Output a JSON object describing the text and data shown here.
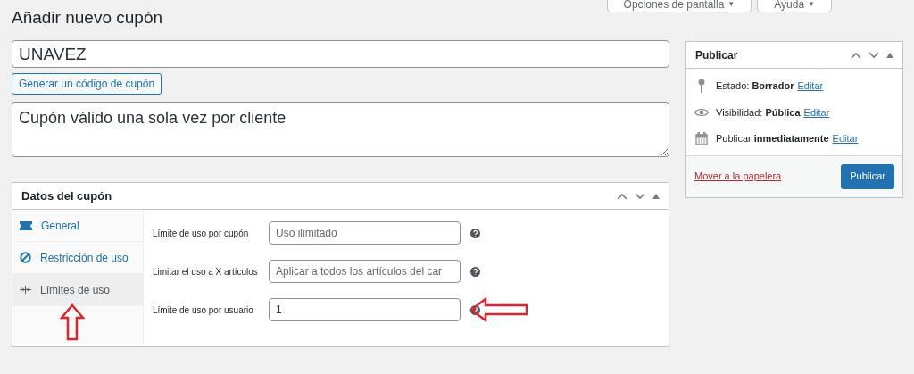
{
  "top_buttons": [
    {
      "label": "Opciones de pantalla",
      "caret": "▼"
    },
    {
      "label": "Ayuda",
      "caret": "▼"
    }
  ],
  "title": "Añadir nuevo cupón",
  "coupon_code": {
    "value": "UNAVEZ"
  },
  "generate_button": "Generar un código de cupón",
  "description": {
    "value": "Cupón válido una sola vez por cliente"
  },
  "coupon_data": {
    "title": "Datos del cupón",
    "tabs": [
      {
        "label": "General",
        "kind": "ticket",
        "selected": false
      },
      {
        "label": "Restricción de uso",
        "kind": "ban",
        "selected": false
      },
      {
        "label": "Límites de uso",
        "kind": "limits",
        "selected": true
      }
    ],
    "fields": [
      {
        "label": "Límite de uso por cupón",
        "placeholder": "Uso ilimitado"
      },
      {
        "label": "Limitar el uso a X artículos",
        "placeholder": "Aplicar a todos los artículos del car"
      },
      {
        "label": "Límite de uso por usuario",
        "value": "1"
      }
    ]
  },
  "publish": {
    "title": "Publicar",
    "rows": [
      {
        "kind": "pin",
        "label": "Estado:",
        "value": "Borrador",
        "link": "Editar"
      },
      {
        "kind": "eye",
        "label": "Visibilidad:",
        "value": "Pública",
        "link": "Editar"
      },
      {
        "kind": "calendar",
        "label": "Publicar",
        "value": "inmediatamente",
        "link": "Editar"
      }
    ],
    "trash_link": "Mover a la papelera",
    "publish_button": "Publicar"
  }
}
